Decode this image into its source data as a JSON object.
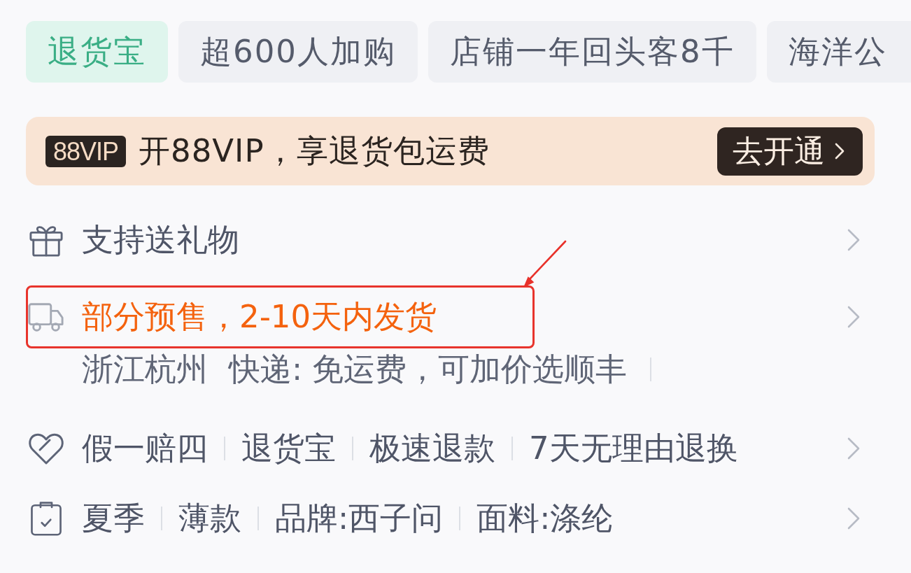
{
  "tags": [
    {
      "label": "退货宝",
      "kind": "service"
    },
    {
      "label": "超600人加购",
      "kind": "plain"
    },
    {
      "label": "店铺一年回头客8千",
      "kind": "plain"
    },
    {
      "label": "海洋公",
      "kind": "plain"
    }
  ],
  "vip_banner": {
    "badge": "88VIP",
    "text": "开88VIP，享退货包运费",
    "button": "去开通"
  },
  "rows": [
    {
      "kind": "gift",
      "text": "支持送礼物",
      "highlighted": false
    },
    {
      "kind": "shipping",
      "text": "部分预售，2-10天内发货",
      "highlighted": true,
      "details": [
        "浙江杭州",
        "快递: 免运费，可加价选顺丰"
      ]
    },
    {
      "kind": "guarantee",
      "items": [
        "假一赔四",
        "退货宝",
        "极速退款",
        "7天无理由退换"
      ],
      "highlighted": false
    },
    {
      "kind": "attributes",
      "items": [
        "夏季",
        "薄款",
        "品牌:西子问",
        "面料:涤纶"
      ],
      "highlighted": false
    }
  ]
}
